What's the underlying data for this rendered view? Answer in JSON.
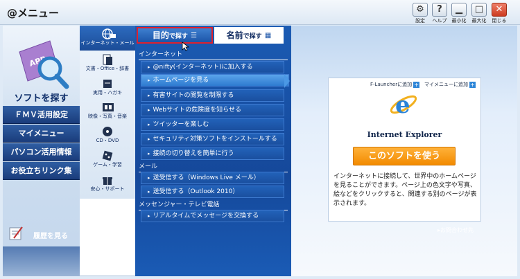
{
  "window": {
    "title": "@メニュー",
    "buttons": [
      {
        "name": "settings",
        "label": "設定",
        "glyph": "⚙"
      },
      {
        "name": "help",
        "label": "ヘルプ",
        "glyph": "?"
      },
      {
        "name": "minimize",
        "label": "最小化",
        "glyph": "▁"
      },
      {
        "name": "maximize",
        "label": "最大化",
        "glyph": "□"
      },
      {
        "name": "close",
        "label": "閉じる",
        "glyph": "✕"
      }
    ]
  },
  "left_nav": {
    "title": "ソフトを探す",
    "items": [
      "ＦＭＶ活用設定",
      "マイメニュー",
      "パソコン活用情報",
      "お役立ちリンク集"
    ],
    "history_label": "履歴を見る"
  },
  "categories": [
    {
      "label": "インターネット・メール",
      "icon": "globe-mail-icon"
    },
    {
      "label": "文書・Office・辞書",
      "icon": "document-icon"
    },
    {
      "label": "実用・ハガキ",
      "icon": "postcard-icon"
    },
    {
      "label": "映像・写真・音楽",
      "icon": "film-icon"
    },
    {
      "label": "CD・DVD",
      "icon": "disc-icon"
    },
    {
      "label": "ゲーム・学習",
      "icon": "dice-icon"
    },
    {
      "label": "安心・サポート",
      "icon": "gift-icon"
    }
  ],
  "tabs": {
    "purpose": {
      "main": "目的",
      "small": "で探す"
    },
    "name": {
      "main": "名前",
      "small": "で探す"
    }
  },
  "sections": [
    {
      "title": "インターネット",
      "items": [
        "@nifty(インターネット)に加入する",
        "ホームページを見る",
        "有害サイトの閲覧を制限する",
        "Webサイトの危険度を知らせる",
        "ツイッターを楽しむ",
        "セキュリティ対策ソフトをインストールする",
        "接続の切り替えを簡単に行う"
      ]
    },
    {
      "title": "メール",
      "items": [
        "送受信する（Windows Live メール）",
        "送受信する（Outlook 2010）"
      ]
    },
    {
      "title": "メッセンジャー・テレビ電話",
      "items": [
        "リアルタイムでメッセージを交換する"
      ]
    }
  ],
  "selected_item": "ホームページを見る",
  "detail": {
    "add_flauncher": "F-Launcherに追加",
    "add_mymenu": "マイメニューに追加",
    "software_name": "Internet Explorer",
    "use_button": "このソフトを使う",
    "description": "インターネットに接続して、世界中のホームページを見ることができます。ページ上の色文字や写真、絵などをクリックすると、関連する別のページが表示されます。",
    "contact": "▸お問合わせ先"
  },
  "colors": {
    "accent": "#1a4f9f",
    "selected_tab_border": "#e0202c",
    "use_button": "#f28a00"
  }
}
